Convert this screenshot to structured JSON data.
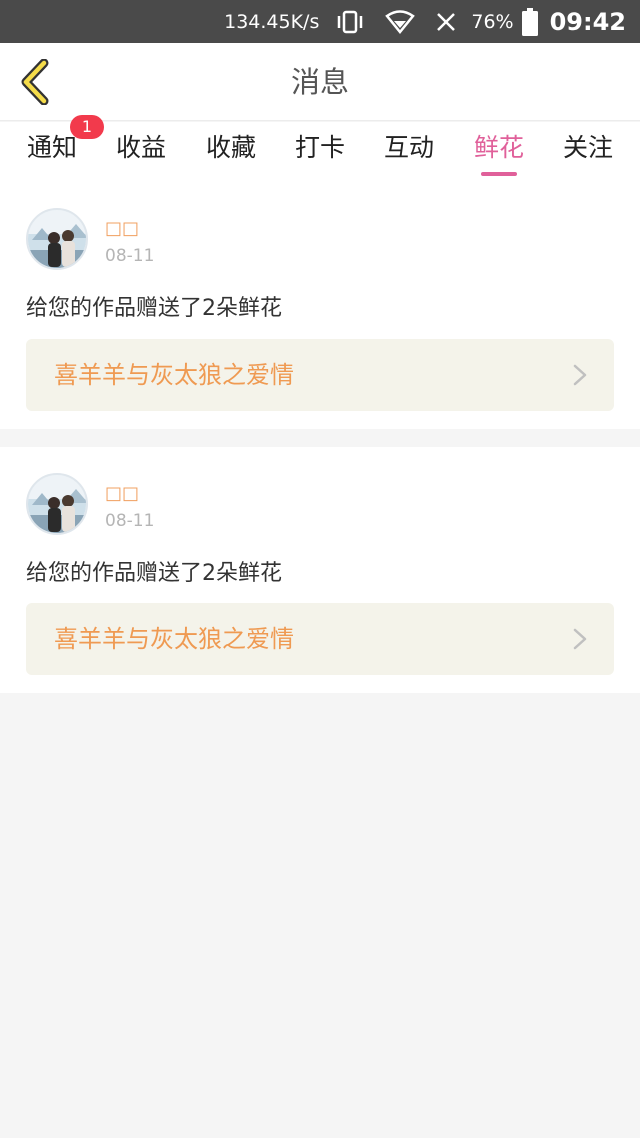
{
  "status_bar": {
    "net_speed": "134.45K/s",
    "battery": "76%",
    "time": "09:42"
  },
  "header": {
    "title": "消息",
    "back_icon": "chevron-left-icon"
  },
  "tabs": [
    {
      "label": "通知",
      "badge": "1",
      "active": false
    },
    {
      "label": "收益",
      "active": false
    },
    {
      "label": "收藏",
      "active": false
    },
    {
      "label": "打卡",
      "active": false
    },
    {
      "label": "互动",
      "active": false
    },
    {
      "label": "鲜花",
      "active": true
    },
    {
      "label": "关注",
      "active": false
    }
  ],
  "messages": [
    {
      "user": "□□",
      "date": "08-11",
      "text": "给您的作品赠送了2朵鲜花",
      "work_title": "喜羊羊与灰太狼之爱情"
    },
    {
      "user": "□□",
      "date": "08-11",
      "text": "给您的作品赠送了2朵鲜花",
      "work_title": "喜羊羊与灰太狼之爱情"
    }
  ],
  "colors": {
    "accent": "#e0609a",
    "badge": "#f23a4c",
    "work_title": "#ef9a52",
    "status_bar": "#4a4a4a"
  }
}
